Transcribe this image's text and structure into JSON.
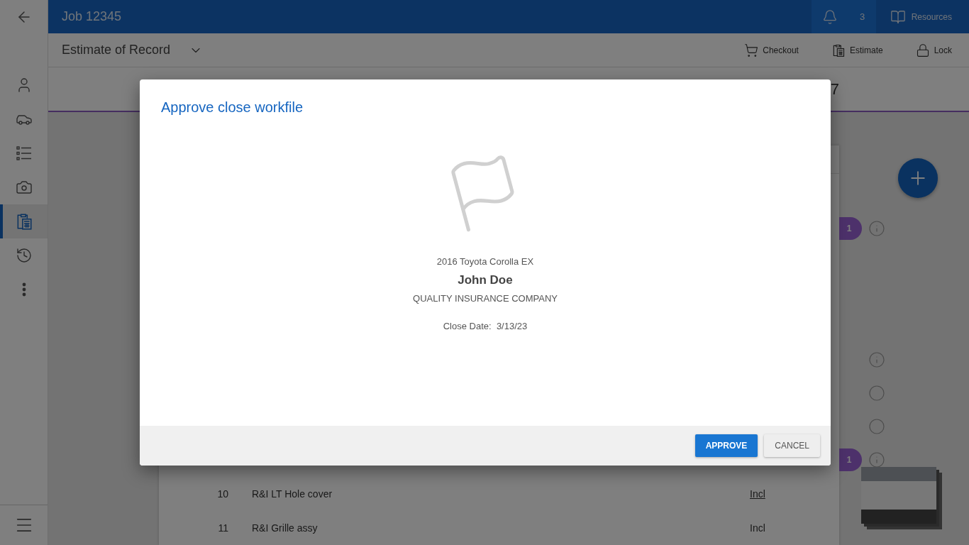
{
  "sidebar": {
    "items": [
      {
        "kind": "person",
        "selected": false
      },
      {
        "kind": "car",
        "selected": false
      },
      {
        "kind": "list",
        "selected": false
      },
      {
        "kind": "camera",
        "selected": false
      },
      {
        "kind": "estimate",
        "selected": true
      },
      {
        "kind": "history",
        "selected": false
      },
      {
        "kind": "more",
        "selected": false
      }
    ]
  },
  "top_bar": {
    "title": "Job 12345",
    "notification_count": "3",
    "resources_label": "Resources"
  },
  "sub_bar": {
    "title": "Estimate of Record",
    "actions": [
      {
        "kind": "cart",
        "label": "Checkout"
      },
      {
        "kind": "estimate",
        "label": "Estimate"
      },
      {
        "kind": "lock",
        "label": "Lock"
      }
    ]
  },
  "summary_strip": {
    "text": "7"
  },
  "lines": [
    {
      "number": "10",
      "description": "R&I LT Hole cover",
      "status": "Incl",
      "linked": true
    },
    {
      "number": "11",
      "description": "R&I Grille assy",
      "status": "Incl",
      "linked": false
    }
  ],
  "side_markers_top": [
    {
      "kind": "badge_info",
      "badge": "1"
    }
  ],
  "side_markers": [
    {
      "kind": "info"
    },
    {
      "kind": "circle"
    },
    {
      "kind": "circle"
    },
    {
      "kind": "badge_info",
      "badge": "1"
    }
  ],
  "dialog": {
    "title": "Approve close workfile",
    "vehicle": "2016 Toyota Corolla EX",
    "owner": "John Doe",
    "insurer": "QUALITY INSURANCE COMPANY",
    "close_date_label": "Close Date:",
    "close_date": "3/13/23",
    "buttons": [
      {
        "kind": "primary",
        "label": "APPROVE"
      },
      {
        "kind": "secondary",
        "label": "CANCEL"
      }
    ]
  }
}
